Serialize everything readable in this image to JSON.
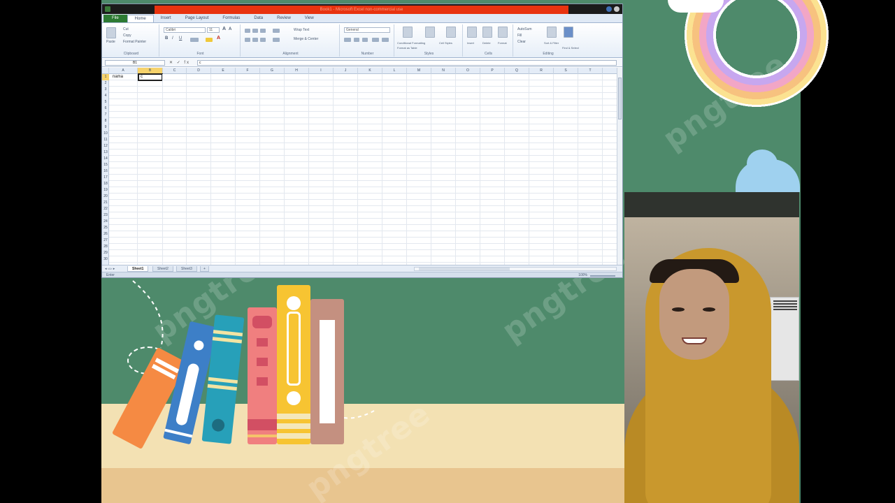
{
  "excel": {
    "title": "Book1 - Microsoft Excel non-commercial use",
    "tabs": [
      "File",
      "Home",
      "Insert",
      "Page Layout",
      "Formulas",
      "Data",
      "Review",
      "View"
    ],
    "ribbon": {
      "clipboard": {
        "label": "Clipboard",
        "paste": "Paste",
        "cut": "Cut",
        "copy": "Copy",
        "format_painter": "Format Painter"
      },
      "font": {
        "label": "Font",
        "name": "Calibri",
        "size": "11"
      },
      "alignment": {
        "label": "Alignment",
        "wrap": "Wrap Text",
        "merge": "Merge & Center"
      },
      "number": {
        "label": "Number",
        "format": "General"
      },
      "styles": {
        "label": "Styles",
        "conditional": "Conditional Formatting",
        "format_table": "Format as Table",
        "cell_styles": "Cell Styles"
      },
      "cells": {
        "label": "Cells",
        "insert": "Insert",
        "delete": "Delete",
        "format": "Format"
      },
      "editing": {
        "label": "Editing",
        "autosum": "AutoSum",
        "fill": "Fill",
        "clear": "Clear",
        "sort": "Sort & Filter",
        "find": "Find & Select"
      }
    },
    "name_box": "B1",
    "formula_icons": "✕ ✓ fx",
    "formula_value": "c",
    "columns": [
      "A",
      "B",
      "C",
      "D",
      "E",
      "F",
      "G",
      "H",
      "I",
      "J",
      "K",
      "L",
      "M",
      "N",
      "O",
      "P",
      "Q",
      "R",
      "S",
      "T"
    ],
    "selected_column": "B",
    "rows": [
      "1",
      "2",
      "3",
      "4",
      "5",
      "6",
      "7",
      "8",
      "9",
      "10",
      "11",
      "12",
      "13",
      "14",
      "15",
      "16",
      "17",
      "18",
      "19",
      "20",
      "21",
      "22",
      "23",
      "24",
      "25",
      "26",
      "27",
      "28",
      "29",
      "30"
    ],
    "cell_a1": "nama",
    "cell_b1": "c",
    "sheets": [
      "Sheet1",
      "Sheet2",
      "Sheet3"
    ],
    "sheet_nav": "◂ ◃ ▹ ▸",
    "status": "Enter",
    "zoom": "100%"
  },
  "watermark": "pngtree"
}
